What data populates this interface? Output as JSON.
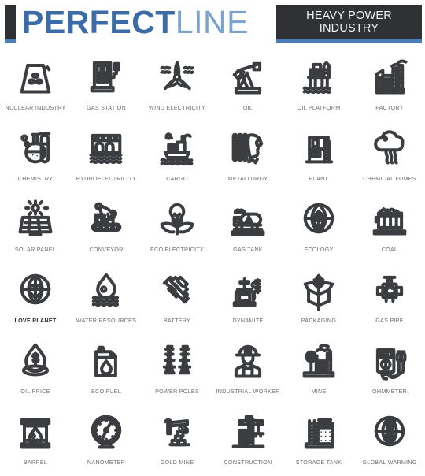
{
  "header": {
    "brand_primary": "PERFECT",
    "brand_secondary": "LINE",
    "badge_label": "HEAVY POWER\nINDUSTRY",
    "accent_color": "#4a7ebb",
    "dark_color": "#303134",
    "brand_primary_color": "#3c6ca8",
    "brand_secondary_color": "#7ba3cd"
  },
  "grid": {
    "columns": 6,
    "rows": 6,
    "stroke_color": "#3b3d40",
    "label_color": "#6d6f72",
    "label_accent_color": "#26282b",
    "icons": [
      {
        "label": "NUCLEAR INDUSTRY",
        "icon": "nuclear-plant-icon",
        "highlight": false
      },
      {
        "label": "GAS STATION",
        "icon": "fuel-pump-icon",
        "highlight": false
      },
      {
        "label": "WIND ELECTRICITY",
        "icon": "wind-turbine-icon",
        "highlight": false
      },
      {
        "label": "OIL",
        "icon": "pumpjack-icon",
        "highlight": false
      },
      {
        "label": "OIL PLATFORM",
        "icon": "oil-rig-icon",
        "highlight": false
      },
      {
        "label": "FACTORY",
        "icon": "factory-icon",
        "highlight": false
      },
      {
        "label": "CHEMISTRY",
        "icon": "flask-testtube-icon",
        "highlight": false
      },
      {
        "label": "HYDROELECTRICITY",
        "icon": "dam-icon",
        "highlight": false
      },
      {
        "label": "CARGO",
        "icon": "cargo-ship-icon",
        "highlight": false
      },
      {
        "label": "METALLURGY",
        "icon": "molten-metal-icon",
        "highlight": false
      },
      {
        "label": "PLANT",
        "icon": "plant-building-icon",
        "highlight": false
      },
      {
        "label": "CHEMICAL FUMES",
        "icon": "fume-cloud-icon",
        "highlight": false
      },
      {
        "label": "SOLAR PANEL",
        "icon": "solar-panel-icon",
        "highlight": false
      },
      {
        "label": "CONVEYOR",
        "icon": "robot-conveyor-icon",
        "highlight": false
      },
      {
        "label": "ECO ELECTRICITY",
        "icon": "bulb-leaves-icon",
        "highlight": false
      },
      {
        "label": "GAS TANK",
        "icon": "tanker-truck-icon",
        "highlight": false
      },
      {
        "label": "ECOLOGY",
        "icon": "globe-leaf-icon",
        "highlight": false
      },
      {
        "label": "COAL",
        "icon": "coal-cart-icon",
        "highlight": false
      },
      {
        "label": "LOVE PLANET",
        "icon": "globe-heart-icon",
        "highlight": true
      },
      {
        "label": "WATER RESOURCES",
        "icon": "water-drop-waves-icon",
        "highlight": false
      },
      {
        "label": "BATTERY",
        "icon": "battery-icon",
        "highlight": false
      },
      {
        "label": "DYNAMITE",
        "icon": "detonator-icon",
        "highlight": false
      },
      {
        "label": "PACKAGING",
        "icon": "open-box-icon",
        "highlight": false
      },
      {
        "label": "GAS PIPE",
        "icon": "valve-icon",
        "highlight": false
      },
      {
        "label": "OIL PRICE",
        "icon": "drop-dollar-icon",
        "highlight": false
      },
      {
        "label": "ECO FUEL",
        "icon": "jerrycan-icon",
        "highlight": false
      },
      {
        "label": "POWER POLES",
        "icon": "pylons-icon",
        "highlight": false
      },
      {
        "label": "INDUSTRIAL WORKER",
        "icon": "worker-helmet-icon",
        "highlight": false
      },
      {
        "label": "MINE",
        "icon": "mine-plant-icon",
        "highlight": false
      },
      {
        "label": "OHMMETER",
        "icon": "multimeter-icon",
        "highlight": false
      },
      {
        "label": "BARREL",
        "icon": "oil-barrel-icon",
        "highlight": false
      },
      {
        "label": "NANOMETER",
        "icon": "gauge-icon",
        "highlight": false
      },
      {
        "label": "GOLD MINE",
        "icon": "gold-bars-pickaxe-icon",
        "highlight": false
      },
      {
        "label": "CONSTRUCTION",
        "icon": "crane-icon",
        "highlight": false
      },
      {
        "label": "STORAGE TANK",
        "icon": "storage-tank-icon",
        "highlight": false
      },
      {
        "label": "GLOBAL WARMING",
        "icon": "globe-thermometer-icon",
        "highlight": false
      }
    ]
  }
}
